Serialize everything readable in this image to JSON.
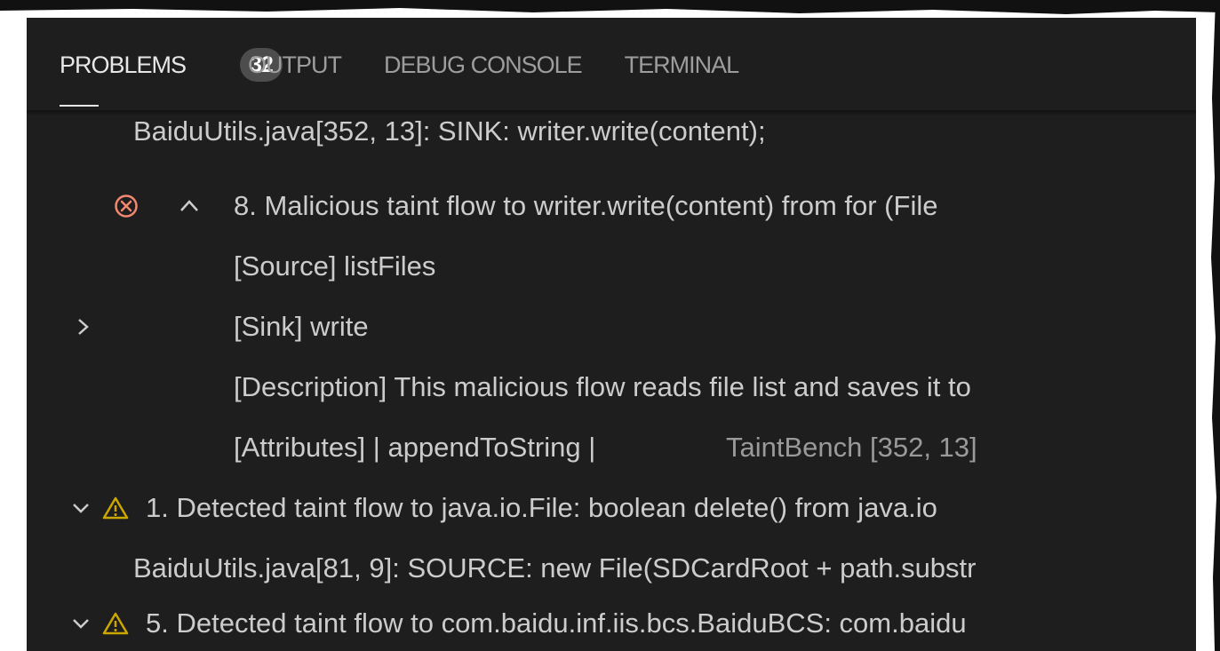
{
  "tabs": [
    {
      "label": "PROBLEMS",
      "active": true
    },
    {
      "label": "OUTPUT",
      "active": false
    },
    {
      "label": "DEBUG CONSOLE",
      "active": false
    },
    {
      "label": "TERMINAL",
      "active": false
    }
  ],
  "problems_count": "32",
  "rows": {
    "cut_sink": "BaiduUtils.java[352, 13]: SINK: writer.write(content);",
    "error_title": "8. Malicious taint flow to writer.write(content) from for (File",
    "source": "[Source] listFiles",
    "sink": "[Sink] write",
    "description": "[Description] This malicious flow reads file list and saves it to",
    "attributes": "[Attributes] | appendToString |",
    "attributes_origin": "TaintBench  [352, 13]",
    "warning1_title": "1. Detected taint flow to java.io.File: boolean delete() from java.io",
    "warning1_source": "BaiduUtils.java[81, 9]: SOURCE: new File(SDCardRoot + path.substr",
    "warning5_title": "5. Detected taint flow to com.baidu.inf.iis.bcs.BaiduBCS: com.baidu"
  },
  "colors": {
    "panel_bg": "#1e1e1e",
    "error": "#f48771",
    "warning": "#cca700",
    "text": "#cccccc"
  }
}
